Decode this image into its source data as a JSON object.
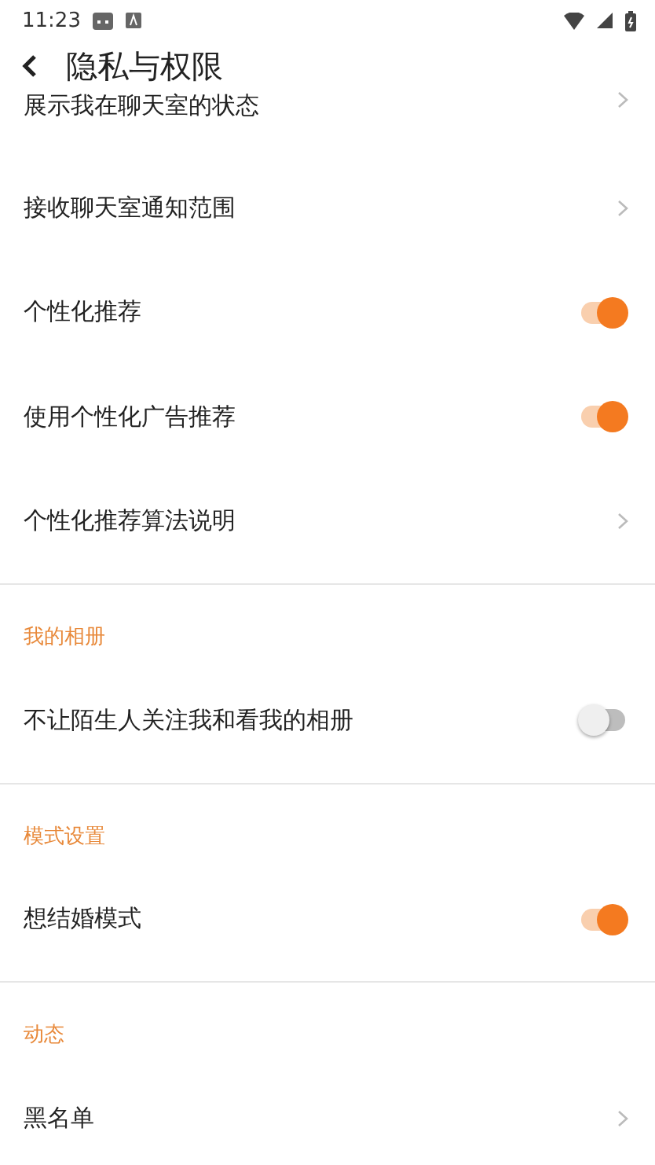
{
  "status_bar": {
    "time": "11:23"
  },
  "header": {
    "title": "隐私与权限"
  },
  "sections": [
    {
      "items": [
        {
          "label": "展示我在聊天室的状态",
          "kind": "link"
        },
        {
          "label": "接收聊天室通知范围",
          "kind": "link"
        },
        {
          "label": "个性化推荐",
          "kind": "toggle",
          "on": true
        },
        {
          "label": "使用个性化广告推荐",
          "kind": "toggle",
          "on": true
        },
        {
          "label": "个性化推荐算法说明",
          "kind": "link"
        }
      ]
    },
    {
      "title": "我的相册",
      "items": [
        {
          "label": "不让陌生人关注我和看我的相册",
          "kind": "toggle",
          "on": false
        }
      ]
    },
    {
      "title": "模式设置",
      "items": [
        {
          "label": "想结婚模式",
          "kind": "toggle",
          "on": true
        }
      ]
    },
    {
      "title": "动态",
      "items": [
        {
          "label": "黑名单",
          "kind": "link"
        }
      ]
    }
  ]
}
